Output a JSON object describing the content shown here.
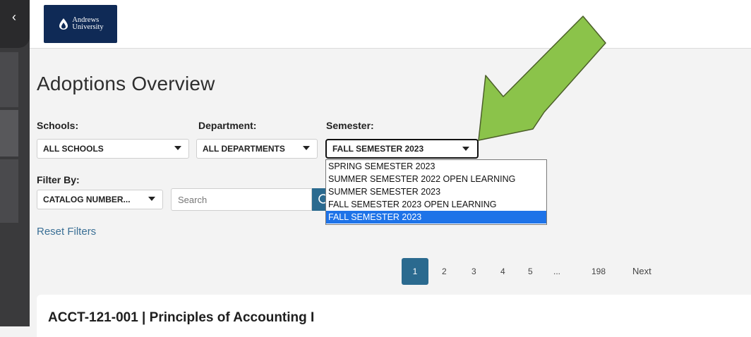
{
  "header": {
    "logo_line1": "Andrews",
    "logo_line2": "University"
  },
  "page": {
    "title": "Adoptions Overview"
  },
  "filters": {
    "schools_label": "Schools:",
    "schools_value": "ALL SCHOOLS",
    "department_label": "Department:",
    "department_value": "ALL DEPARTMENTS",
    "semester_label": "Semester:",
    "semester_value": "FALL SEMESTER 2023",
    "filter_by_label": "Filter By:",
    "filter_by_value": "CATALOG NUMBER...",
    "search_placeholder": "Search",
    "reset_label": "Reset Filters"
  },
  "semester_options": [
    "SPRING SEMESTER 2023",
    "SUMMER SEMESTER 2022 OPEN LEARNING",
    "SUMMER SEMESTER 2023",
    "FALL SEMESTER 2023 OPEN LEARNING",
    "FALL SEMESTER 2023"
  ],
  "pagination": {
    "current": "1",
    "pages": [
      "2",
      "3",
      "4",
      "5",
      "...",
      "198"
    ],
    "next_label": "Next"
  },
  "course": {
    "title": "ACCT-121-001 | Principles of Accounting I"
  },
  "colors": {
    "accent": "#2b6a8f",
    "link": "#3a6f95",
    "selected_option": "#1e73e8",
    "annotation_arrow": "#8bc34a",
    "logo_bg": "#0f2a56"
  },
  "icons": {
    "collapse": "chevron-left-icon",
    "search": "search-icon",
    "annotation": "arrow-annotation-icon"
  }
}
